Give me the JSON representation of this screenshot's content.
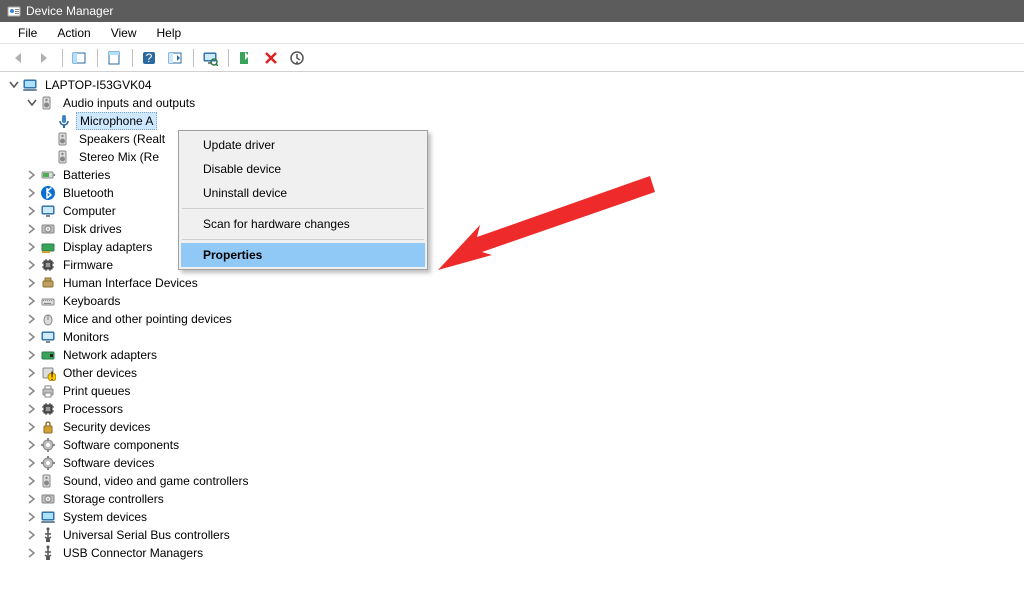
{
  "window": {
    "title": "Device Manager"
  },
  "menubar": {
    "items": [
      "File",
      "Action",
      "View",
      "Help"
    ]
  },
  "tree": {
    "root": "LAPTOP-I53GVK04",
    "audio_category": "Audio inputs and outputs",
    "audio_children": {
      "microphone": "Microphone A",
      "speakers": "Speakers (Realt",
      "stereo": "Stereo Mix (Re"
    },
    "categories": [
      "Batteries",
      "Bluetooth",
      "Computer",
      "Disk drives",
      "Display adapters",
      "Firmware",
      "Human Interface Devices",
      "Keyboards",
      "Mice and other pointing devices",
      "Monitors",
      "Network adapters",
      "Other devices",
      "Print queues",
      "Processors",
      "Security devices",
      "Software components",
      "Software devices",
      "Sound, video and game controllers",
      "Storage controllers",
      "System devices",
      "Universal Serial Bus controllers",
      "USB Connector Managers"
    ]
  },
  "context_menu": {
    "items": {
      "update": "Update driver",
      "disable": "Disable device",
      "uninstall": "Uninstall device",
      "scan": "Scan for hardware changes",
      "properties": "Properties"
    }
  }
}
